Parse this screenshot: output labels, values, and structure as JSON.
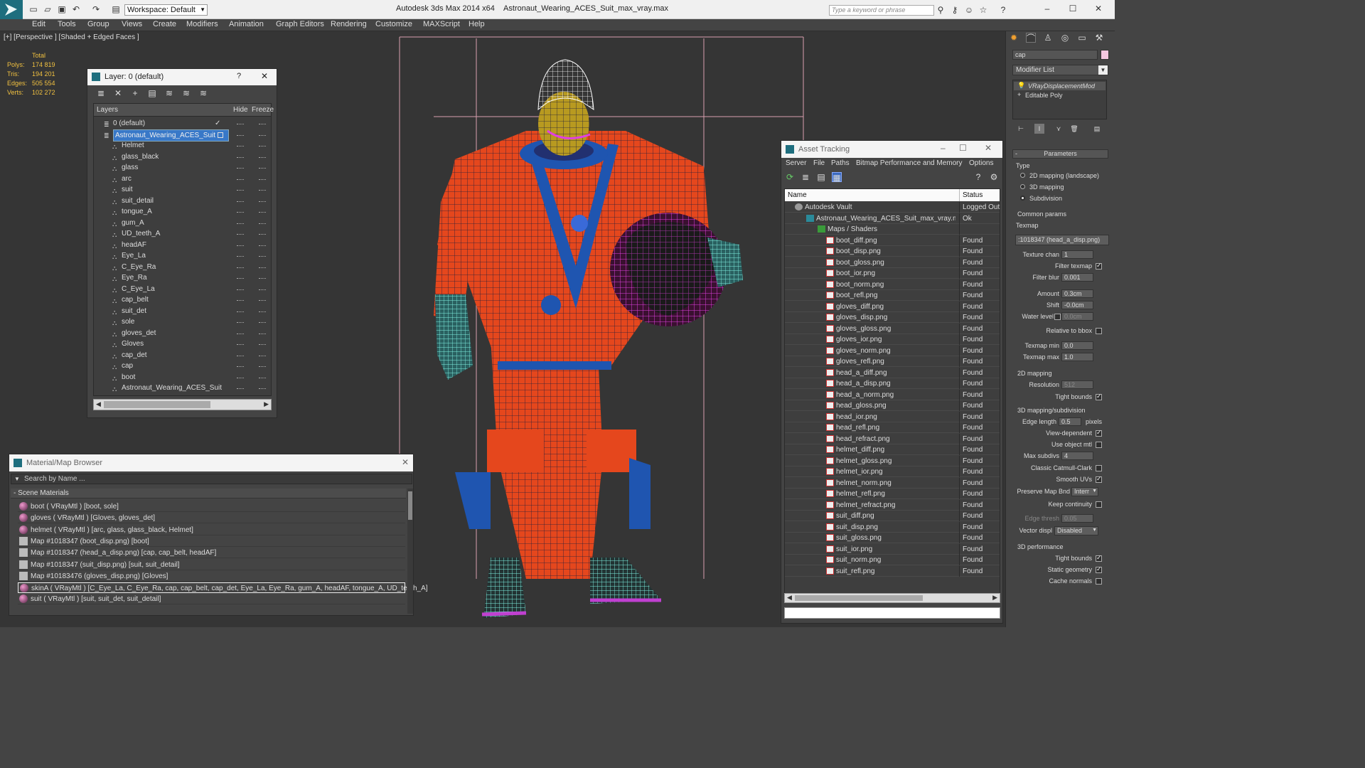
{
  "app": {
    "title": "Autodesk 3ds Max  2014 x64",
    "file": "Astronaut_Wearing_ACES_Suit_max_vray.max",
    "workspace": "Workspace: Default",
    "search_placeholder": "Type a keyword or phrase",
    "icon": "app-3dsmax-icon"
  },
  "menu": [
    "Edit",
    "Tools",
    "Group",
    "Views",
    "Create",
    "Modifiers",
    "Animation",
    "Graph Editors",
    "Rendering",
    "Customize",
    "MAXScript",
    "Help"
  ],
  "viewport": {
    "label": "[+] [Perspective ] [Shaded + Edged Faces ]",
    "stats": {
      "total_label": "Total",
      "rows": [
        {
          "label": "Polys:",
          "value": "174 819"
        },
        {
          "label": "Tris:",
          "value": "194 201"
        },
        {
          "label": "Edges:",
          "value": "505 554"
        },
        {
          "label": "Verts:",
          "value": "102 272"
        }
      ]
    }
  },
  "layer_window": {
    "title": "Layer: 0 (default)",
    "help": "?",
    "columns": {
      "layers": "Layers",
      "hide": "Hide",
      "freeze": "Freeze"
    },
    "items": [
      "0 (default)",
      "Astronaut_Wearing_ACES_Suit",
      "Helmet",
      "glass_black",
      "glass",
      "arc",
      "suit",
      "suit_detail",
      "tongue_A",
      "gum_A",
      "UD_teeth_A",
      "headAF",
      "Eye_La",
      "C_Eye_Ra",
      "Eye_Ra",
      "C_Eye_La",
      "cap_belt",
      "suit_det",
      "sole",
      "gloves_det",
      "Gloves",
      "cap_det",
      "cap",
      "boot",
      "Astronaut_Wearing_ACES_Suit"
    ]
  },
  "material_browser": {
    "title": "Material/Map Browser",
    "search_placeholder": "Search by Name ...",
    "section": "- Scene Materials",
    "items": [
      "boot  ( VRayMtl ) [boot, sole]",
      "gloves  ( VRayMtl ) [Gloves, gloves_det]",
      "helmet  ( VRayMtl ) [arc, glass, glass_black, Helmet]",
      "Map #1018347 (boot_disp.png) [boot]",
      "Map #1018347 (head_a_disp.png) [cap, cap_belt, headAF]",
      "Map #1018347 (suit_disp.png) [suit, suit_detail]",
      "Map #10183476 (gloves_disp.png) [Gloves]",
      "skinA  ( VRayMtl ) [C_Eye_La, C_Eye_Ra, cap, cap_belt, cap_det, Eye_La, Eye_Ra, gum_A, headAF, tongue_A, UD_teeth_A]",
      "suit  ( VRayMtl ) [suit, suit_det, suit_detail]"
    ]
  },
  "asset_tracking": {
    "title": "Asset Tracking",
    "menu": [
      "Server",
      "File",
      "Paths",
      "Bitmap Performance and Memory",
      "Options"
    ],
    "columns": {
      "name": "Name",
      "status": "Status"
    },
    "vault": {
      "name": "Autodesk Vault",
      "status": "Logged Out"
    },
    "file": {
      "name": "Astronaut_Wearing_ACES_Suit_max_vray.max",
      "status": "Ok"
    },
    "group": "Maps / Shaders",
    "maps": [
      "boot_diff.png",
      "boot_disp.png",
      "boot_gloss.png",
      "boot_ior.png",
      "boot_norm.png",
      "boot_refl.png",
      "gloves_diff.png",
      "gloves_disp.png",
      "gloves_gloss.png",
      "gloves_ior.png",
      "gloves_norm.png",
      "gloves_refl.png",
      "head_a_diff.png",
      "head_a_disp.png",
      "head_a_norm.png",
      "head_gloss.png",
      "head_ior.png",
      "head_refl.png",
      "head_refract.png",
      "helmet_diff.png",
      "helmet_gloss.png",
      "helmet_ior.png",
      "helmet_norm.png",
      "helmet_refl.png",
      "helmet_refract.png",
      "suit_diff.png",
      "suit_disp.png",
      "suit_gloss.png",
      "suit_ior.png",
      "suit_norm.png",
      "suit_refl.png"
    ],
    "map_status": "Found"
  },
  "command_panel": {
    "object_name": "cap",
    "modifier_list": "Modifier List",
    "stack": [
      "VRayDisplacementMod",
      "Editable Poly"
    ],
    "rollout": "Parameters",
    "type_label": "Type",
    "type_options": [
      "2D mapping (landscape)",
      "3D mapping",
      "Subdivision"
    ],
    "common_label": "Common params",
    "texmap_label": "Texmap",
    "texmap_value": ":1018347 (head_a_disp.png)",
    "texture_chan": {
      "label": "Texture chan",
      "value": "1"
    },
    "filter_texmap": "Filter texmap",
    "filter_blur": {
      "label": "Filter blur",
      "value": "0.001"
    },
    "amount": {
      "label": "Amount",
      "value": "0.3cm"
    },
    "shift": {
      "label": "Shift",
      "value": "-0.0cm"
    },
    "water_level": {
      "label": "Water level",
      "value": "0.0cm"
    },
    "relative_bbox": "Relative to bbox",
    "texmap_min": {
      "label": "Texmap min",
      "value": "0.0"
    },
    "texmap_max": {
      "label": "Texmap max",
      "value": "1.0"
    },
    "mapping2d": "2D mapping",
    "resolution": {
      "label": "Resolution",
      "value": "512"
    },
    "tight_bounds": "Tight bounds",
    "mapping3d": "3D mapping/subdivision",
    "edge_length": {
      "label": "Edge length",
      "value": "0.5",
      "unit": "pixels"
    },
    "view_dependent": "View-dependent",
    "use_object_mtl": "Use object mtl",
    "max_subdivs": {
      "label": "Max subdivs",
      "value": "4"
    },
    "classic": "Classic Catmull-Clark",
    "smooth_uvs": "Smooth UVs",
    "preserve": {
      "label": "Preserve Map Bnd",
      "value": "Interr"
    },
    "keep_continuity": "Keep continuity",
    "edge_thresh": {
      "label": "Edge thresh",
      "value": "0.05"
    },
    "vector_displ": {
      "label": "Vector displ",
      "value": "Disabled"
    },
    "perf": "3D performance",
    "perf_tight": "Tight bounds",
    "static_geometry": "Static geometry",
    "cache_normals": "Cache normals"
  }
}
